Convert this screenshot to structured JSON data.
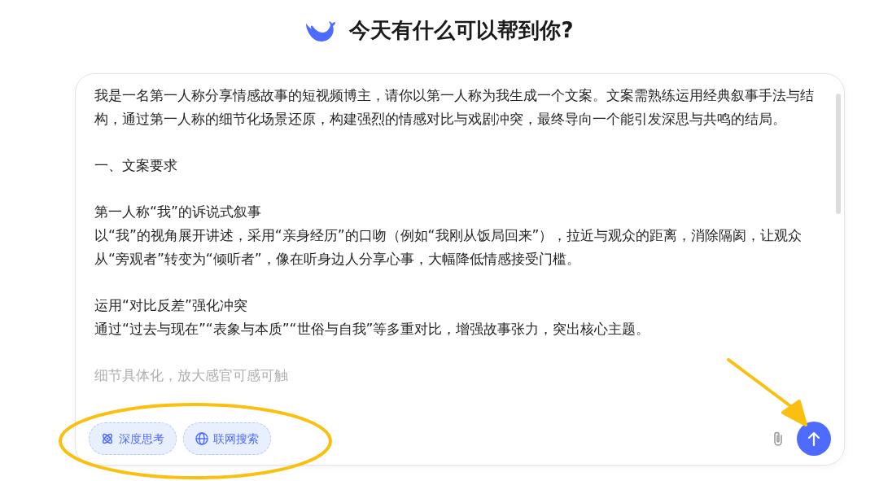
{
  "header": {
    "title": "今天有什么可以帮到你?"
  },
  "input": {
    "blocks": [
      [
        "我是一名第一人称分享情感故事的短视频博主，请你以第一人称为我生成一个文案。文案需熟练运用经典叙事手法与结构，通过第一人称的细节化场景还原，构建强烈的情感对比与戏剧冲突，最终导向一个能引发深思与共鸣的结局。"
      ],
      [
        "一、文案要求"
      ],
      [
        "第一人称“我”的诉说式叙事",
        "以“我”的视角展开讲述，采用“亲身经历”的口吻（例如“我刚从饭局回来”），拉近与观众的距离，消除隔阂，让观众从“旁观者”转变为“倾听者”，像在听身边人分享心事，大幅降低情感接受门槛。"
      ],
      [
        "运用“对比反差”强化冲突",
        "通过“过去与现在”“表象与本质”“世俗与自我”等多重对比，增强故事张力，突出核心主题。"
      ],
      [
        "细节具体化，放大感官可感可触"
      ]
    ]
  },
  "toggles": [
    {
      "label": "深度思考",
      "kind": "think",
      "selected": true
    },
    {
      "label": "联网搜索",
      "kind": "web",
      "selected": true
    }
  ]
}
